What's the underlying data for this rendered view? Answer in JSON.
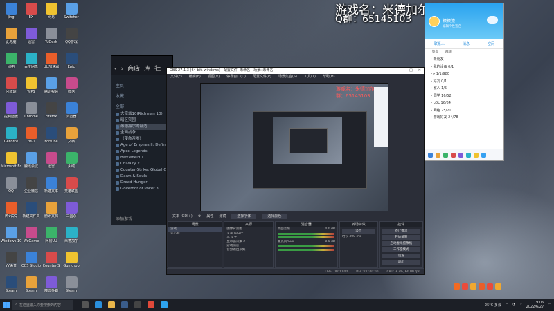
{
  "overlay": {
    "line1": "游戏名：米德加尔的部落",
    "line2": "Q群：65145103"
  },
  "desktop_icons": {
    "col1": [
      "Jing",
      "此电脑",
      "网络",
      "回收站",
      "控制面板",
      "GeForce",
      "Microsoft Edge",
      "QQ",
      "腾讯QQ",
      "Windows 10 更新",
      "YY语音",
      "Steam",
      "Blender"
    ],
    "col2": [
      "EX",
      "迅雷",
      "百度网盘",
      "WPS",
      "Chrome",
      "360",
      "腾讯会议",
      "企业微信",
      "新建文件夹",
      "WeGame",
      "OBS Studio",
      "Steam",
      "网易云音乐"
    ],
    "col3": [
      "网易",
      "ToDesk",
      "UU加速器",
      "腾讯视频",
      "Firefox",
      "Fortune",
      "迅雷",
      "新建文本",
      "腾讯文档",
      "网易UU",
      "Counter-S",
      "魔兽争霸",
      "Blender"
    ],
    "col4": [
      "Switcher",
      "QQ游戏",
      "Epic",
      "微信",
      "浏览器",
      "文档",
      "火绒",
      "英雄联盟",
      "三国杀",
      "米德加尔",
      "Gumdrop",
      "Steam",
      "Dota 2"
    ]
  },
  "steam": {
    "nav_store": "商店",
    "nav_library": "库",
    "nav_community": "社",
    "home_label": "主页",
    "collections_label": "收藏",
    "all_label": "全部",
    "games": [
      "大富翁10(Richman 10)",
      "暗区突围",
      "米德加尔的部落",
      "全面战争",
      "《使命召唤》",
      "Age of Empires II: Definitive",
      "Apex Legends",
      "Battlefield 1",
      "Chivalry 2",
      "Counter-Strike: Global Off",
      "Dawn & Souls",
      "Dread Hunger",
      "Governor of Poker 3"
    ],
    "selected_game_index": 2,
    "add_game_label": "添加游戏"
  },
  "obs": {
    "title": "OBS 27.1.3 (64-bit, windows) - 配置文件: 未命名 - 场景: 未命名",
    "menu": [
      "文件(F)",
      "编辑(E)",
      "视图(V)",
      "停靠窗口(D)",
      "配置文件(P)",
      "场景集合(S)",
      "工具(T)",
      "帮助(H)"
    ],
    "preview_overlay": "游戏名：米德加尔 Q群：65145103",
    "toolbar_source": "文本 (GDI+)",
    "toolbar_props": "属性",
    "toolbar_filters": "滤镜",
    "toolbar_select": "选择字体",
    "toolbar_color": "选择颜色",
    "docks": {
      "scenes_title": "场景",
      "scenes": [
        "游戏",
        "显示器"
      ],
      "sources_title": "来源",
      "sources": [
        "图像背景图",
        "文本 (GDI+)",
        "三 文字",
        "显示器采集 2",
        "游戏捕获",
        "音频输出采集"
      ],
      "mixer_title": "混音器",
      "mixer_tracks": [
        "桌面音频",
        "麦克风/Aux"
      ],
      "mixer_db": [
        "0.0 dB",
        "0.0 dB"
      ],
      "transitions_title": "转场特效",
      "transition_value": "淡出",
      "duration_label": "时长",
      "duration_value": "300 ms",
      "controls_title": "控件",
      "controls": [
        "停止推流",
        "开始录制",
        "启动虚拟摄像机",
        "工作室模式",
        "设置",
        "退出"
      ]
    },
    "status": {
      "live": "LIVE: 00:00:00",
      "rec": "REC: 00:00:00",
      "cpu": "CPU: 3.3%, 60.00 fps"
    }
  },
  "qq": {
    "name": "猿猿猿",
    "signature": "编辑个性签名",
    "tabs": [
      "联系人",
      "消息",
      "空间"
    ],
    "subtabs": [
      "好友",
      "群聊"
    ],
    "groups": [
      "新朋友",
      "我的设备 0/1",
      "▸ 1/1/980",
      "好友 0/1",
      "家人 1/5",
      "同学 16/52",
      "LOL 16/64",
      "网络 25/71",
      "游戏好友 24/78"
    ]
  },
  "taskbar": {
    "search_placeholder": "在这里输入你要搜索的内容",
    "weather": "25°C 多云",
    "time": "19:06",
    "date": "2022/6/27"
  }
}
